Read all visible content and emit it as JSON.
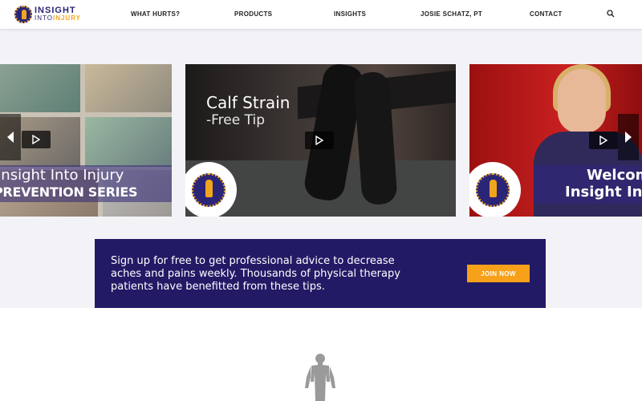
{
  "header": {
    "logo": {
      "top": "INSIGHT",
      "bottom_a": "INTO",
      "bottom_b": "INJURY"
    },
    "nav": [
      "WHAT HURTS?",
      "PRODUCTS",
      "INSIGHTS",
      "JOSIE SCHATZ, PT",
      "CONTACT"
    ],
    "search_icon": "search-icon"
  },
  "slides": [
    {
      "title": "Insight Into Injury",
      "subtitle": "PREVENTION SERIES"
    },
    {
      "title": "Calf Strain",
      "subtitle": "-Free Tip"
    },
    {
      "title": "Welcome",
      "subtitle": "Insight Into"
    }
  ],
  "signup": {
    "text": "Sign up for free to get professional advice to decrease aches and pains weekly. Thousands of physical therapy patients have benefitted from these tips.",
    "button": "JOIN NOW"
  },
  "colors": {
    "brand_navy": "#231a66",
    "brand_orange": "#f6a119",
    "hero_bg": "#f3f3f7"
  }
}
